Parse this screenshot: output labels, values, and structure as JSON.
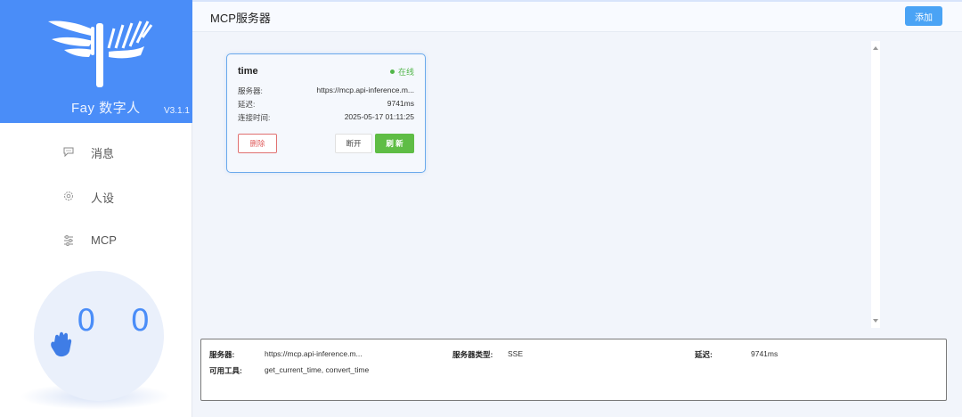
{
  "sidebar": {
    "brand_name": "Fay 数字人",
    "version": "V3.1.1",
    "items": [
      {
        "label": "消息",
        "icon": "chat-bubble-icon"
      },
      {
        "label": "人设",
        "icon": "gear-icon"
      },
      {
        "label": "MCP",
        "icon": "sliders-icon"
      }
    ],
    "avatar": {
      "eyes": "0 0",
      "icon": "waving-hand-icon"
    }
  },
  "header": {
    "title": "MCP服务器",
    "add_label": "添加"
  },
  "server_card": {
    "name": "time",
    "status": "在线",
    "fields": [
      {
        "label": "服务器:",
        "value": "https://mcp.api-inference.m..."
      },
      {
        "label": "延迟:",
        "value": "9741ms"
      },
      {
        "label": "连接时间:",
        "value": "2025-05-17 01:11:25"
      }
    ],
    "delete_label": "删除",
    "disconnect_label": "断开",
    "refresh_label": "刷 新"
  },
  "detail": {
    "server_label": "服务器:",
    "server_value": "https://mcp.api-inference.m...",
    "type_label": "服务器类型:",
    "type_value": "SSE",
    "latency_label": "延迟:",
    "latency_value": "9741ms",
    "tools_label": "可用工具:",
    "tools_value": "get_current_time, convert_time"
  },
  "colors": {
    "primary": "#4a8df8",
    "online": "#52b64a",
    "refresh": "#5fbd45",
    "delete": "#e06060",
    "add": "#4aa3f5"
  }
}
